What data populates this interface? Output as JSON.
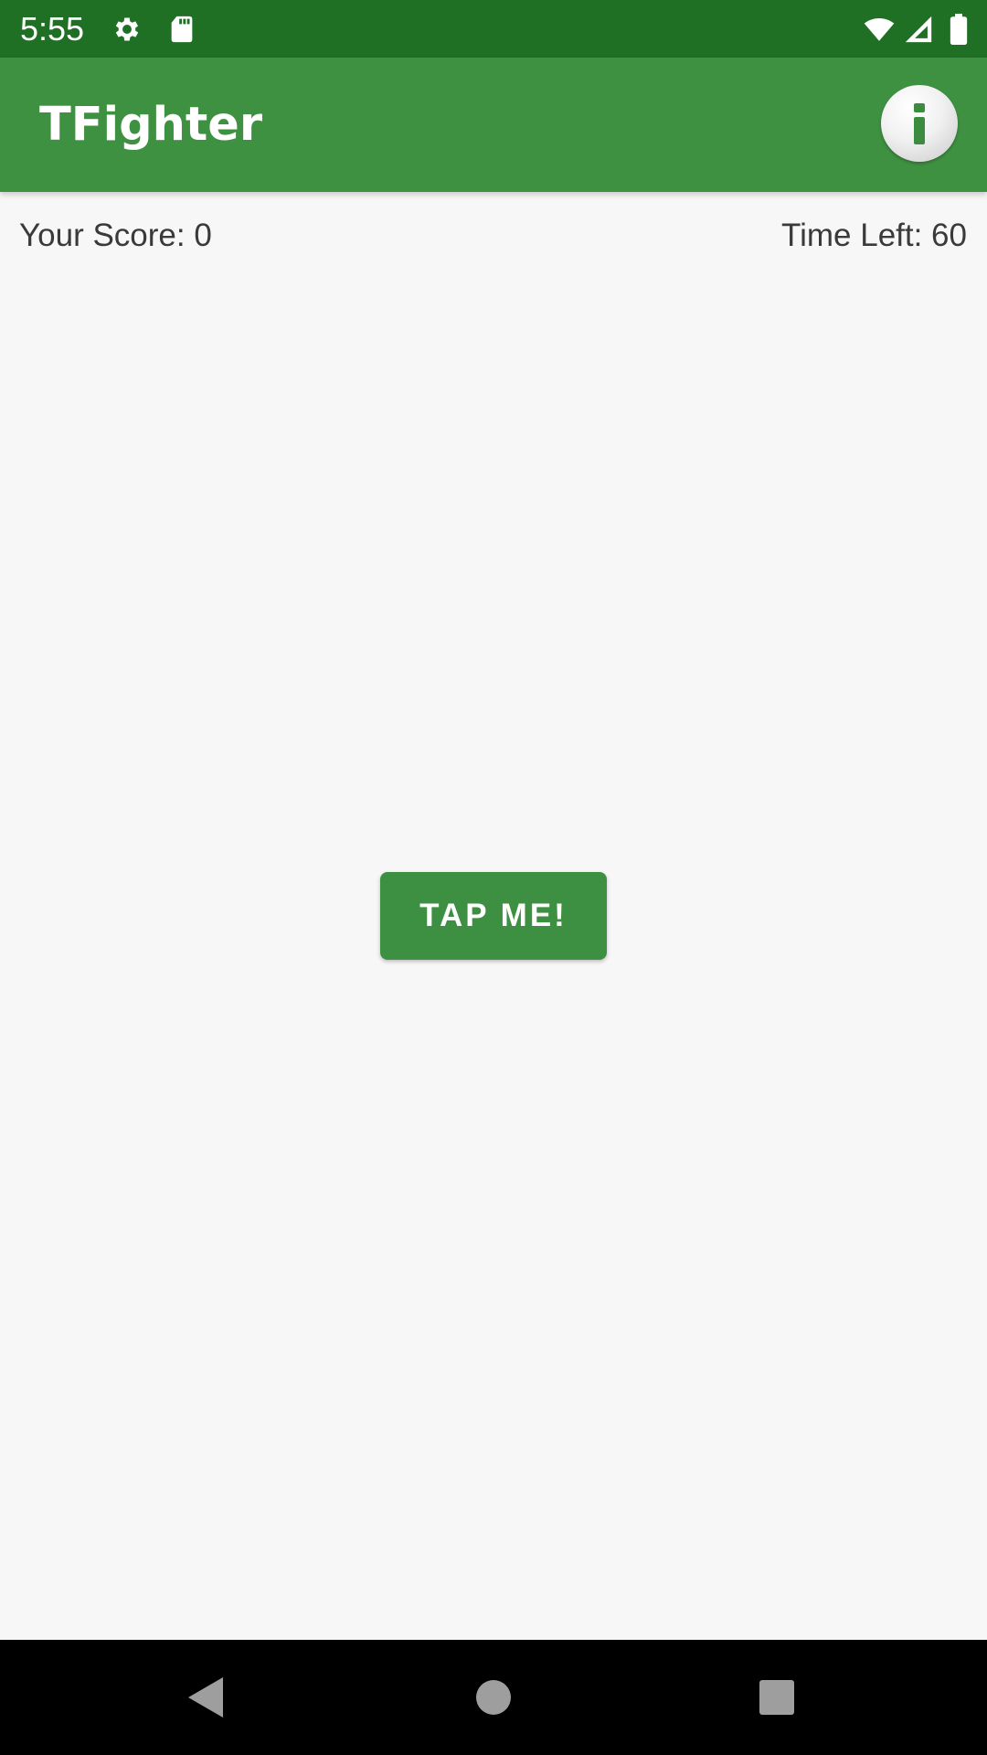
{
  "status_bar": {
    "time": "5:55",
    "icons": [
      "gear-icon",
      "sd-card-icon",
      "wifi-icon",
      "signal-icon",
      "battery-icon"
    ],
    "background": "#1f7024"
  },
  "app_bar": {
    "title": "TFighter",
    "background": "#3f9142",
    "info_icon": "info-icon"
  },
  "game": {
    "score_text": "Your Score: 0",
    "time_text": "Time Left: 60",
    "tap_button_label": "TAP ME!",
    "button_color": "#3d8f41"
  },
  "nav_bar": {
    "buttons": [
      "back-icon",
      "home-icon",
      "recents-icon"
    ]
  }
}
